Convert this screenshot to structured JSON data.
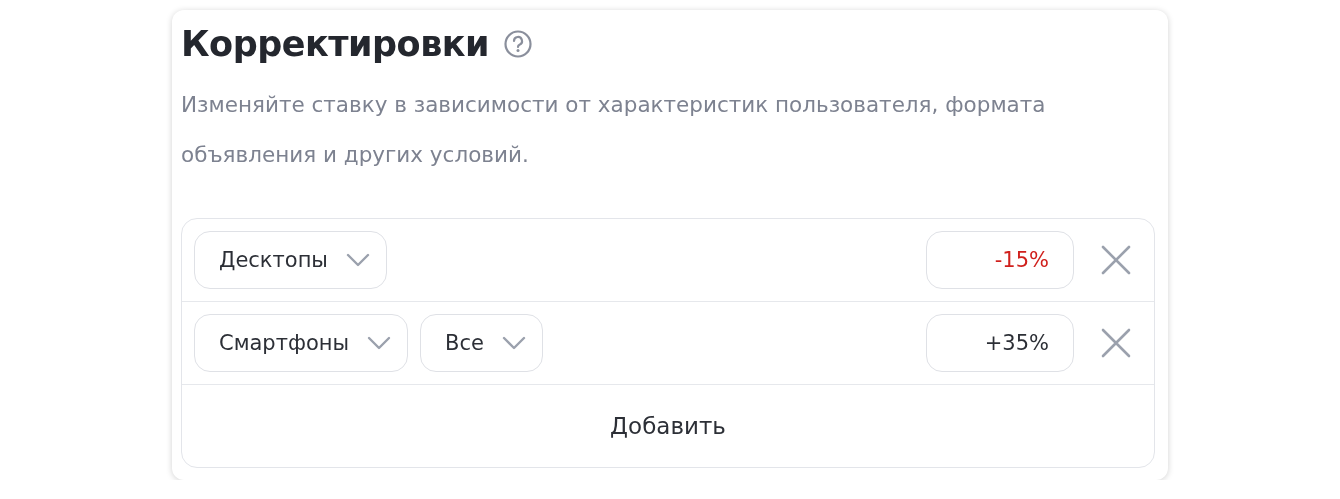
{
  "title": "Корректировки",
  "description": "Изменяйте ставку в зависимости от характеристик пользователя, формата объявления и других условий.",
  "rows": [
    {
      "selects": [
        {
          "label": "Десктопы"
        }
      ],
      "value": "-15%",
      "negative": true
    },
    {
      "selects": [
        {
          "label": "Смартфоны"
        },
        {
          "label": "Все"
        }
      ],
      "value": "+35%",
      "negative": false
    }
  ],
  "add_button": "Добавить"
}
